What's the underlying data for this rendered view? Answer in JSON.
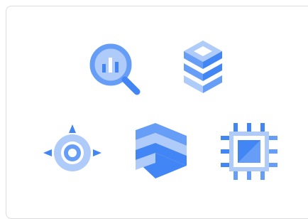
{
  "icons": [
    {
      "name": "bigquery-icon"
    },
    {
      "name": "cloud-sql-icon"
    },
    {
      "name": "artifact-registry-icon"
    },
    {
      "name": "cloud-build-icon"
    },
    {
      "name": "compute-engine-icon"
    }
  ],
  "colors": {
    "dark_blue": "#4285f4",
    "mid_blue": "#669df6",
    "light_blue": "#aecbfa",
    "border": "#dadce0"
  }
}
